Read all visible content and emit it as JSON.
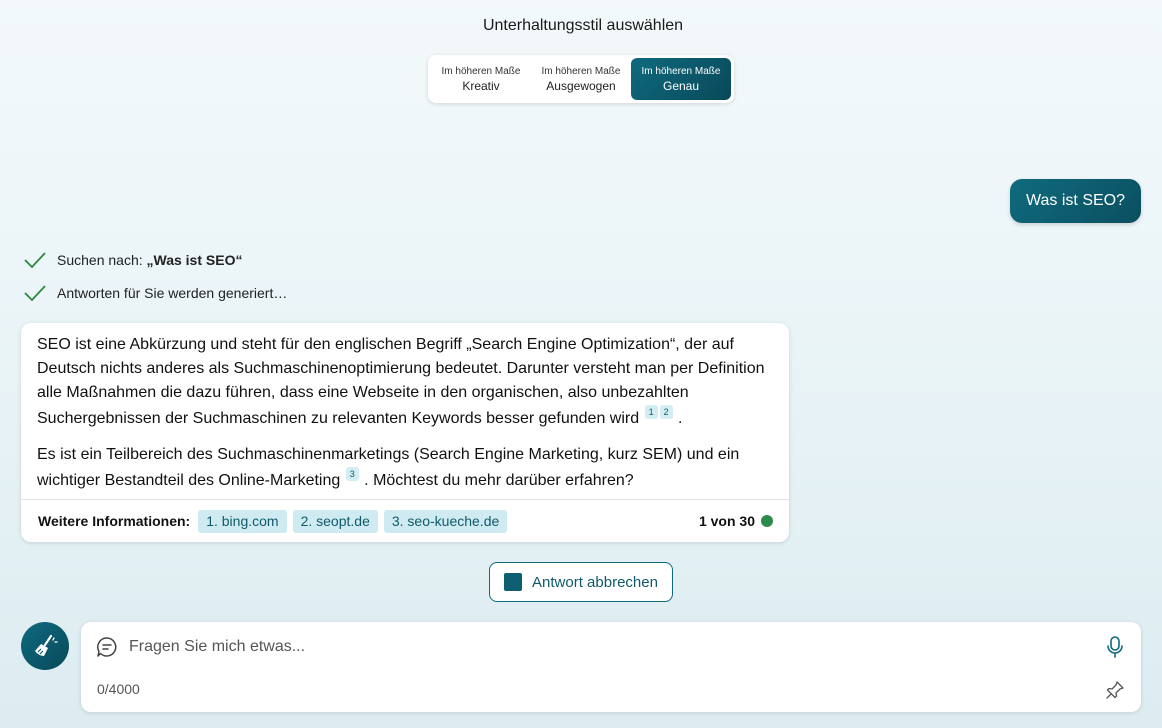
{
  "style_selector": {
    "title": "Unterhaltungsstil auswählen",
    "options": [
      {
        "sub": "Im höheren Maße",
        "main": "Kreativ"
      },
      {
        "sub": "Im höheren Maße",
        "main": "Ausgewogen"
      },
      {
        "sub": "Im höheren Maße",
        "main": "Genau"
      }
    ],
    "active_index": 2
  },
  "user_message": "Was ist SEO?",
  "progress": {
    "search_prefix": "Suchen nach: ",
    "search_query": "„Was ist SEO“",
    "generating": "Antworten für Sie werden generiert…"
  },
  "answer": {
    "p1": "SEO ist eine Abkürzung und steht für den englischen Begriff „Search Engine Optimization“, der auf Deutsch nichts anderes als Suchmaschinenoptimierung bedeutet. Darunter versteht man per Definition alle Maßnahmen die dazu führen, dass eine Webseite in den organischen, also unbezahlten Suchergebnissen der Suchmaschinen zu relevanten Keywords besser gefunden wird",
    "p1_cites": [
      "1",
      "2"
    ],
    "p1_end": ".",
    "p2_a": "Es ist ein Teilbereich des Suchmaschinenmarketings (Search Engine Marketing, kurz SEM) und ein wichtiger Bestandteil des Online-Marketing",
    "p2_cite": "3",
    "p2_b": ". Möchtest du mehr darüber erfahren?"
  },
  "footer": {
    "more_label": "Weitere Informationen:",
    "sources": [
      "1. bing.com",
      "2. seopt.de",
      "3. seo-kueche.de"
    ],
    "count": "1 von 30",
    "status_color": "#2c8a4a"
  },
  "stop_button": "Antwort abbrechen",
  "input": {
    "placeholder": "Fragen Sie mich etwas...",
    "value": "",
    "counter": "0/4000"
  },
  "colors": {
    "accent": "#0f6a7e",
    "accent_dark": "#08495a",
    "check": "#2c8a3a",
    "cite_bg": "#d2eef3"
  },
  "icons": {
    "check": "check-icon",
    "broom": "broom-icon",
    "chat": "chat-bubble-icon",
    "mic": "microphone-icon",
    "pin": "pin-icon",
    "stop": "stop-icon"
  }
}
